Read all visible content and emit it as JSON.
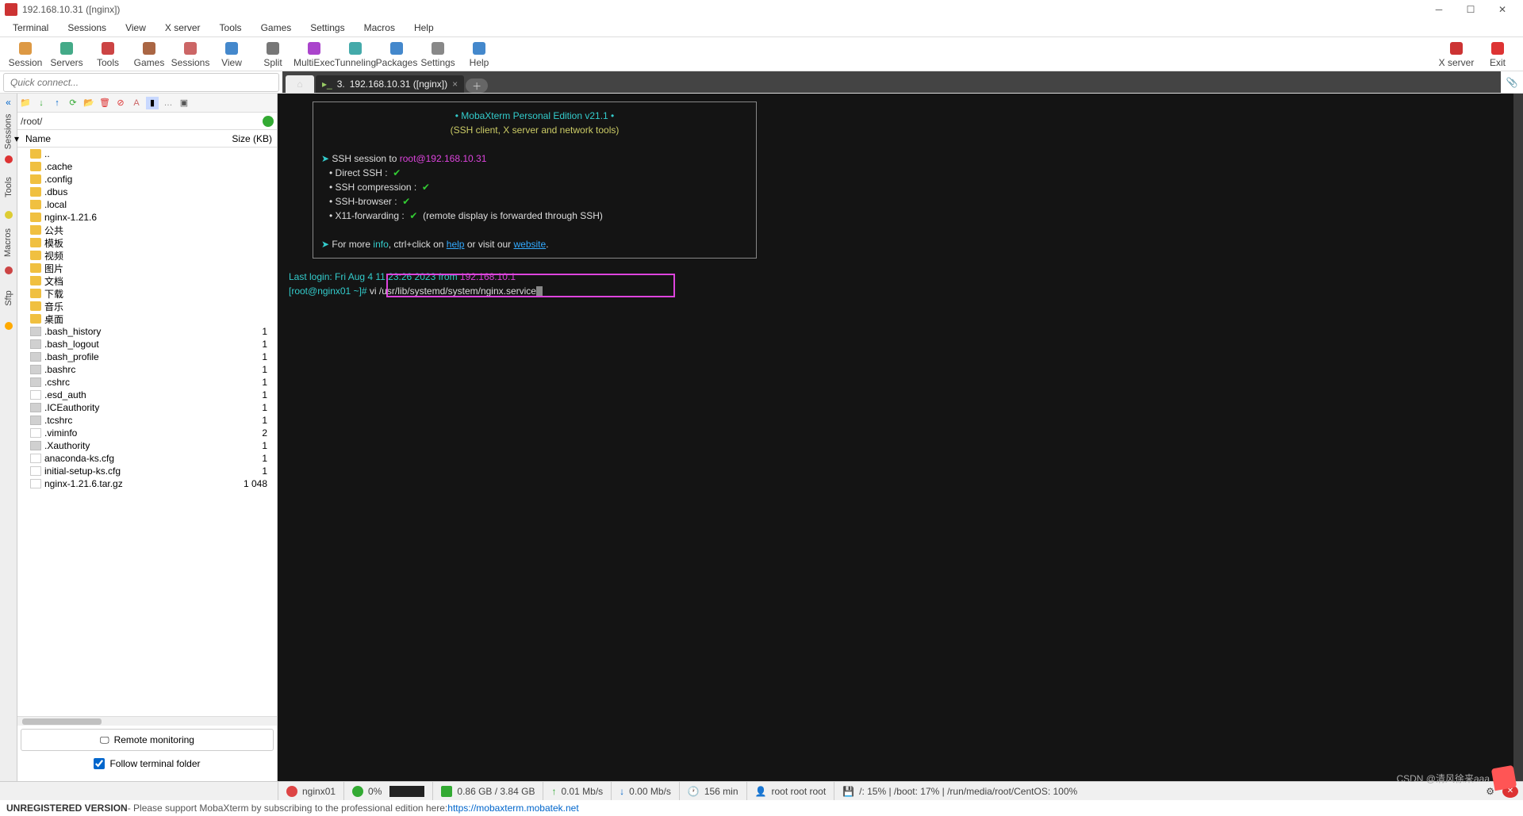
{
  "titlebar": {
    "title": "192.168.10.31 ([nginx])"
  },
  "menubar": [
    "Terminal",
    "Sessions",
    "View",
    "X server",
    "Tools",
    "Games",
    "Settings",
    "Macros",
    "Help"
  ],
  "toolbar_left": [
    {
      "label": "Session",
      "color": "#d94"
    },
    {
      "label": "Servers",
      "color": "#4a8"
    },
    {
      "label": "Tools",
      "color": "#c44"
    },
    {
      "label": "Games",
      "color": "#a64"
    },
    {
      "label": "Sessions",
      "color": "#c66"
    },
    {
      "label": "View",
      "color": "#48c"
    },
    {
      "label": "Split",
      "color": "#777"
    },
    {
      "label": "MultiExec",
      "color": "#a4c"
    },
    {
      "label": "Tunneling",
      "color": "#4aa"
    },
    {
      "label": "Packages",
      "color": "#48c"
    },
    {
      "label": "Settings",
      "color": "#888"
    },
    {
      "label": "Help",
      "color": "#48c"
    }
  ],
  "toolbar_right": [
    {
      "label": "X server",
      "color": "#c33"
    },
    {
      "label": "Exit",
      "color": "#d33"
    }
  ],
  "quick_placeholder": "Quick connect...",
  "tab_home": "⌂",
  "tab_active": {
    "index": "3.",
    "title": "192.168.10.31 ([nginx])",
    "close": "×"
  },
  "tab_plus": "＋",
  "sidetabs": [
    "Sessions",
    "Tools",
    "Macros",
    "Sftp"
  ],
  "sftp": {
    "path": "/root/",
    "head_name": "Name",
    "head_size": "Size (KB)",
    "entries": [
      {
        "n": "..",
        "t": "folder",
        "s": ""
      },
      {
        "n": ".cache",
        "t": "folder",
        "s": ""
      },
      {
        "n": ".config",
        "t": "folder",
        "s": ""
      },
      {
        "n": ".dbus",
        "t": "folder",
        "s": ""
      },
      {
        "n": ".local",
        "t": "folder",
        "s": ""
      },
      {
        "n": "nginx-1.21.6",
        "t": "folder",
        "s": ""
      },
      {
        "n": "公共",
        "t": "folder",
        "s": ""
      },
      {
        "n": "模板",
        "t": "folder",
        "s": ""
      },
      {
        "n": "视频",
        "t": "folder",
        "s": ""
      },
      {
        "n": "图片",
        "t": "folder",
        "s": ""
      },
      {
        "n": "文档",
        "t": "folder",
        "s": ""
      },
      {
        "n": "下载",
        "t": "folder",
        "s": ""
      },
      {
        "n": "音乐",
        "t": "folder",
        "s": ""
      },
      {
        "n": "桌面",
        "t": "folder",
        "s": ""
      },
      {
        "n": ".bash_history",
        "t": "file",
        "s": "1"
      },
      {
        "n": ".bash_logout",
        "t": "file",
        "s": "1"
      },
      {
        "n": ".bash_profile",
        "t": "file",
        "s": "1"
      },
      {
        "n": ".bashrc",
        "t": "file",
        "s": "1"
      },
      {
        "n": ".cshrc",
        "t": "file",
        "s": "1"
      },
      {
        "n": ".esd_auth",
        "t": "filedoc",
        "s": "1"
      },
      {
        "n": ".ICEauthority",
        "t": "file",
        "s": "1"
      },
      {
        "n": ".tcshrc",
        "t": "file",
        "s": "1"
      },
      {
        "n": ".viminfo",
        "t": "filedoc",
        "s": "2"
      },
      {
        "n": ".Xauthority",
        "t": "file",
        "s": "1"
      },
      {
        "n": "anaconda-ks.cfg",
        "t": "filedoc",
        "s": "1"
      },
      {
        "n": "initial-setup-ks.cfg",
        "t": "filedoc",
        "s": "1"
      },
      {
        "n": "nginx-1.21.6.tar.gz",
        "t": "filedoc",
        "s": "1 048"
      }
    ],
    "remote": "Remote monitoring",
    "follow": "Follow terminal folder"
  },
  "term": {
    "banner_title": "• MobaXterm Personal Edition v21.1 •",
    "banner_sub": "(SSH client, X server and network tools)",
    "ssh_pre": "SSH session to ",
    "ssh_host": "root@192.168.10.31",
    "b1": "Direct SSH      :",
    "b2": "SSH compression :",
    "b3": "SSH-browser     :",
    "b4": "X11-forwarding  :",
    "b4_note": "(remote display is forwarded through SSH)",
    "more_pre": "For more ",
    "more_info": "info",
    "more_mid": ", ctrl+click on ",
    "more_help": "help",
    "more_mid2": " or visit our ",
    "more_site": "website",
    "more_end": ".",
    "check": "✔",
    "last_login_pre": "Last login: Fri Aug  4 11:23:26 2023 from ",
    "last_login_ip": "192.168.10.1",
    "prompt_user": "[root@nginx01 ~]# ",
    "cmd": "vi /usr/lib/systemd/system/nginx.service"
  },
  "status": {
    "host": "nginx01",
    "cpu": "0%",
    "mem": "0.86 GB / 3.84 GB",
    "up": "0.01 Mb/s",
    "down": "0.00 Mb/s",
    "uptime": "156 min",
    "users": "root  root  root",
    "disk": "/: 15%  |  /boot: 17%  |  /run/media/root/CentOS: 100%"
  },
  "footer": {
    "unreg": "UNREGISTERED VERSION",
    "msg": "  -  Please support MobaXterm by subscribing to the professional edition here:  ",
    "url": "https://mobaxterm.mobatek.net"
  },
  "watermark": "CSDN @清风徐来aaa"
}
